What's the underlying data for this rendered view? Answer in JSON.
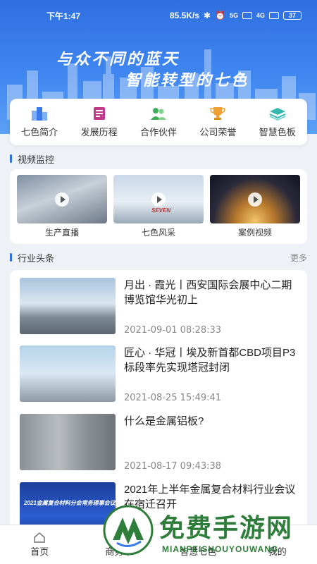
{
  "status_bar": {
    "time": "下午1:47",
    "network_speed": "85.5K/s",
    "signal1_label": "5G",
    "signal2_label": "4G",
    "battery": "37"
  },
  "hero": {
    "slogan_line1": "与众不同的蓝天",
    "slogan_line2": "智能转型的七色",
    "background_color": "#3f86f0"
  },
  "quick_entries": [
    {
      "label": "七色简介",
      "icon": "buildings-icon",
      "color": "#3b7be8"
    },
    {
      "label": "发展历程",
      "icon": "book-icon",
      "color": "#c0398a"
    },
    {
      "label": "合作伙伴",
      "icon": "people-icon",
      "color": "#3fae5a"
    },
    {
      "label": "公司荣誉",
      "icon": "trophy-icon",
      "color": "#f0a030"
    },
    {
      "label": "智慧色板",
      "icon": "stack-icon",
      "color": "#36b7b0"
    }
  ],
  "video_section": {
    "title": "视频监控",
    "items": [
      {
        "label": "生产直播"
      },
      {
        "label": "七色风采",
        "thumb_text": "SEVEN"
      },
      {
        "label": "案例视频"
      }
    ]
  },
  "news_section": {
    "title": "行业头条",
    "more_label": "更多",
    "items": [
      {
        "title": "月出 · 霞光丨西安国际会展中心二期博览馆华光初上",
        "date": "2021-09-01 08:28:33"
      },
      {
        "title": "匠心 · 华冠丨埃及新首都CBD项目P3标段率先实现塔冠封闭",
        "date": "2021-08-25 15:49:41"
      },
      {
        "title": "什么是金属铝板?",
        "date": "2021-08-17 09:43:38"
      },
      {
        "title": "2021年上半年金属复合材料行业会议在宿迁召开",
        "date": "",
        "banner_text": "2021金属复合材料分会常务理事会议"
      }
    ]
  },
  "bottom_nav": {
    "items": [
      {
        "label": "首页",
        "icon": "home-icon"
      },
      {
        "label": "商务中",
        "icon": "briefcase-icon"
      },
      {
        "label": "智慧七色",
        "icon": "grid-icon"
      },
      {
        "label": "我的",
        "icon": "user-icon"
      }
    ]
  },
  "watermark": {
    "main": "免费手游网",
    "sub": "MIANFEISHOUYOUWANG"
  }
}
